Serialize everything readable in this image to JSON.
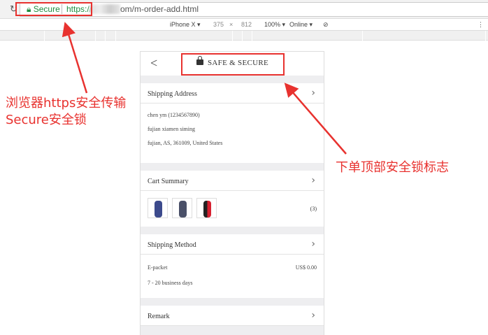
{
  "browser": {
    "secure_label": "Secure",
    "url_scheme": "https://",
    "url_path": "om/m-order-add.html"
  },
  "devtools": {
    "device": "iPhone X ▾",
    "width": "375",
    "x": "×",
    "height": "812",
    "zoom": "100% ▾",
    "network": "Online ▾"
  },
  "header": {
    "back": "<",
    "title": "SAFE & SECURE"
  },
  "shipping_address": {
    "title": "Shipping Address",
    "lines": [
      "chen ym (1234567890)",
      "fujian xiamen siming",
      "fujian, AS, 361009, United States"
    ]
  },
  "cart_summary": {
    "title": "Cart Summary",
    "count": "(3)"
  },
  "shipping_method": {
    "title": "Shipping Method",
    "name": "E-packet",
    "price": "US$ 0.00",
    "days": "7 - 20 business days"
  },
  "remark": {
    "title": "Remark"
  },
  "annotations": {
    "left_1": "浏览器https安全传输",
    "left_2": "Secure安全锁",
    "right": "下单顶部安全锁标志"
  },
  "colors": {
    "annotation": "#e8322f",
    "secure": "#1e8e3e"
  }
}
